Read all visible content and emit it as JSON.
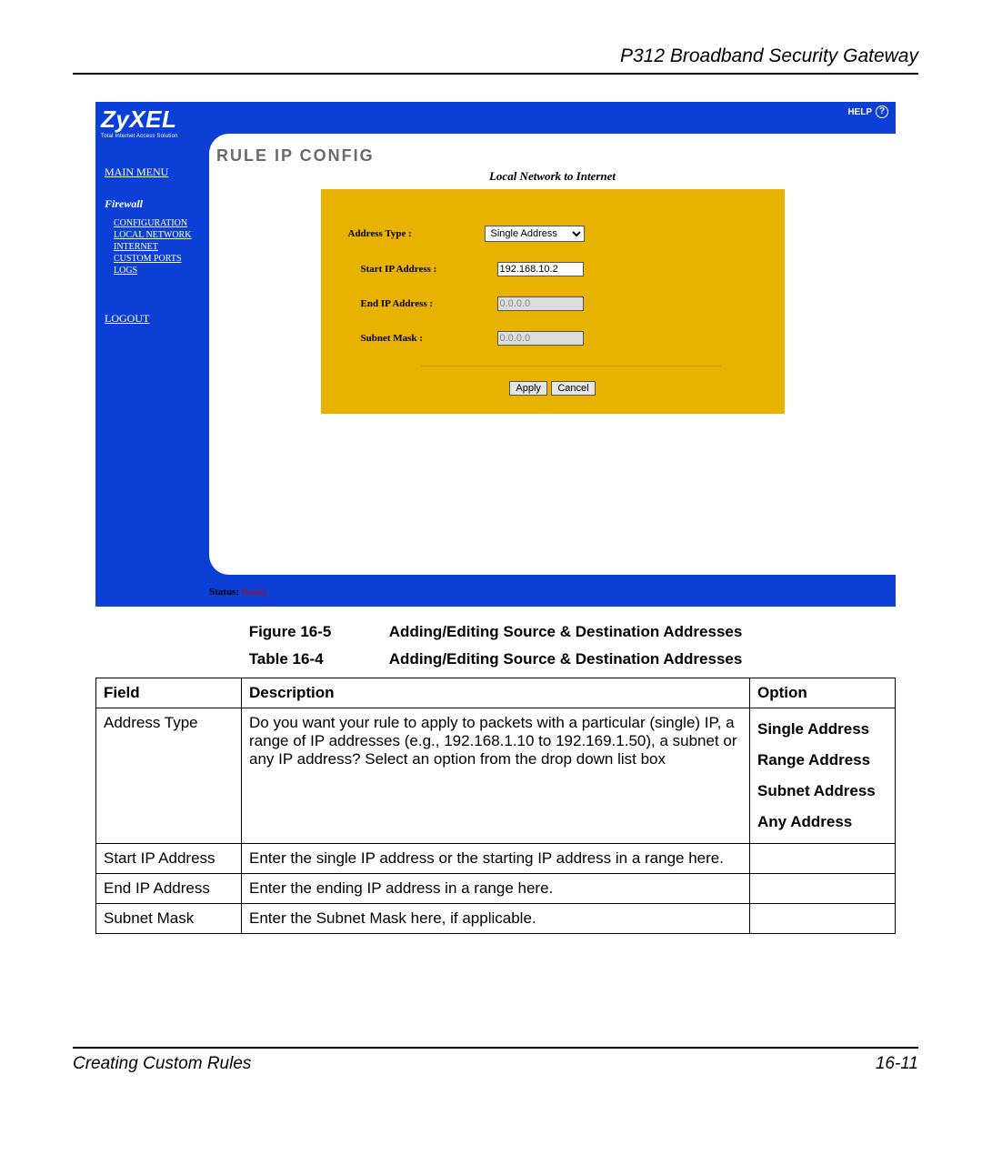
{
  "doc": {
    "header_title": "P312  Broadband Security Gateway",
    "footer_left": "Creating Custom Rules",
    "footer_right": "16-11"
  },
  "app": {
    "logo_main": "ZyXEL",
    "logo_sub": "Total Internet Access Solution",
    "help_label": "HELP",
    "help_q": "?",
    "sidebar": {
      "main_menu": "MAIN MENU",
      "section": "Firewall",
      "items": {
        "config": "CONFIGURATION",
        "local": "LOCAL NETWORK",
        "internet": "INTERNET",
        "custom": "CUSTOM PORTS",
        "logs": "LOGS"
      },
      "logout": "LOGOUT"
    },
    "panel": {
      "title": "RULE IP CONFIG",
      "subtitle": "Local Network to Internet"
    },
    "form": {
      "address_type_label": "Address Type :",
      "address_type_value": "Single Address",
      "start_ip_label": "Start IP Address :",
      "start_ip_value": "192.168.10.2",
      "end_ip_label": "End IP Address :",
      "end_ip_value": "0.0.0.0",
      "subnet_label": "Subnet Mask :",
      "subnet_value": "0.0.0.0",
      "apply": "Apply",
      "cancel": "Cancel"
    },
    "status": {
      "label": "Status:",
      "value": "Ready"
    }
  },
  "captions": {
    "figure_label": "Figure 16-5",
    "figure_text": "Adding/Editing Source & Destination Addresses",
    "table_label": "Table 16-4",
    "table_text": "Adding/Editing Source & Destination Addresses"
  },
  "table": {
    "headers": {
      "field": "Field",
      "desc": "Description",
      "opt": "Option"
    },
    "rows": [
      {
        "field": "Address Type",
        "desc": "Do you want your rule to apply to packets with a particular (single) IP, a range of IP addresses (e.g., 192.168.1.10 to 192.169.1.50), a subnet or any IP address? Select an option from the drop down list box",
        "opt": "Single Address\nRange Address\nSubnet Address\nAny Address"
      },
      {
        "field": "Start IP Address",
        "desc": "Enter the single IP address or the starting IP address in a range here.",
        "opt": ""
      },
      {
        "field": "End IP Address",
        "desc": "Enter the ending IP address in a range here.",
        "opt": ""
      },
      {
        "field": "Subnet Mask",
        "desc": "Enter the Subnet Mask here, if applicable.",
        "opt": ""
      }
    ]
  }
}
